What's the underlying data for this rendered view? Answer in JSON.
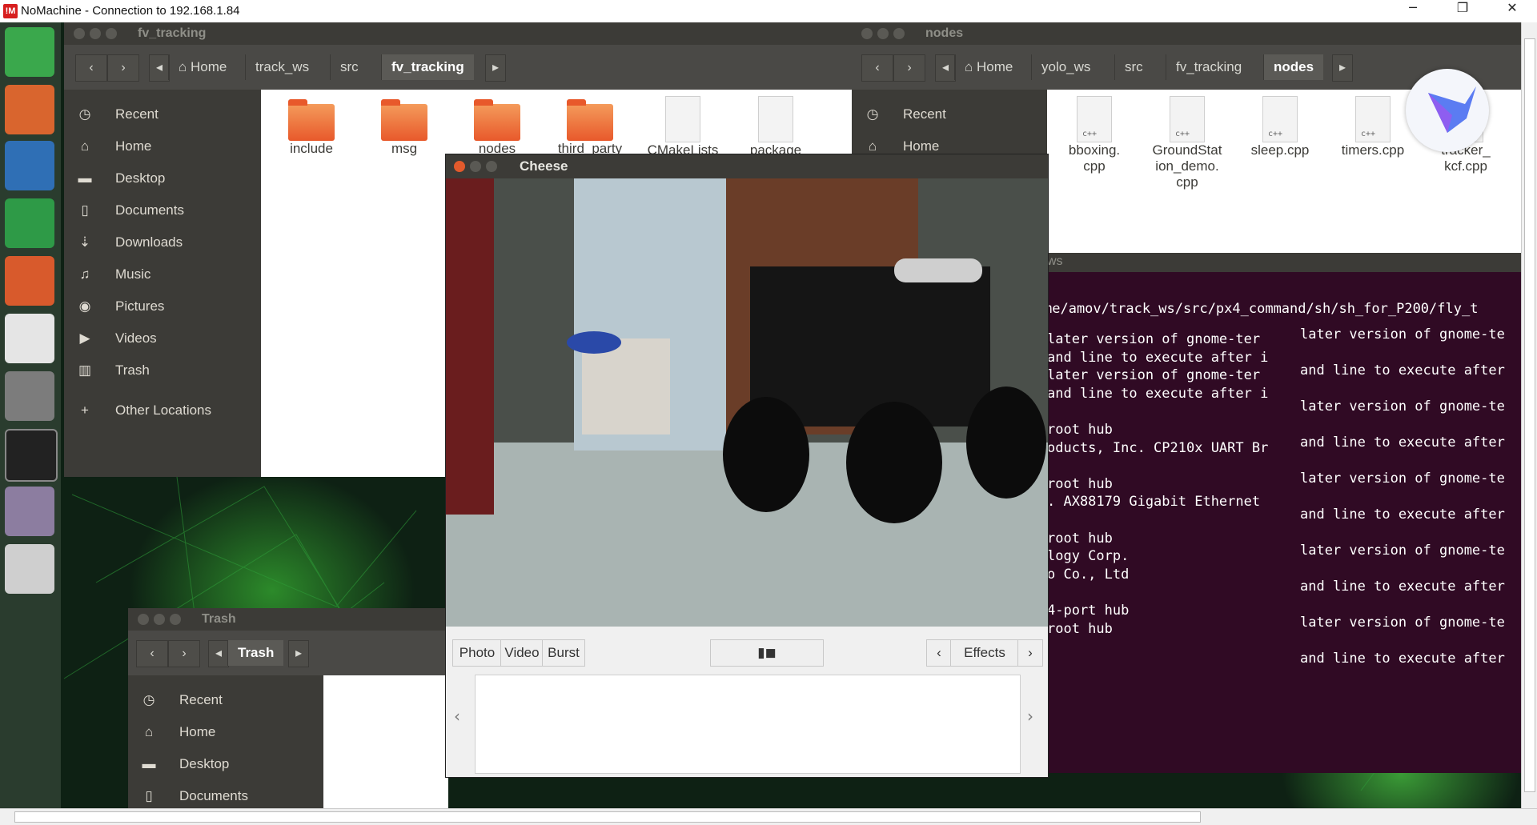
{
  "host": {
    "logo": "!M",
    "title": "NoMachine - Connection to 192.168.1.84",
    "minimize": "─",
    "restore": "❐",
    "close": "✕"
  },
  "fm_left": {
    "title": "fv_tracking",
    "back": "‹",
    "forward": "›",
    "crumb_prev": "◂",
    "crumb_next": "▸",
    "home_icon": "⌂",
    "breadcrumbs": [
      "Home",
      "track_ws",
      "src",
      "fv_tracking"
    ],
    "sidebar": [
      {
        "icon": "◷",
        "label": "Recent"
      },
      {
        "icon": "⌂",
        "label": "Home"
      },
      {
        "icon": "▬",
        "label": "Desktop"
      },
      {
        "icon": "▯",
        "label": "Documents"
      },
      {
        "icon": "⇣",
        "label": "Downloads"
      },
      {
        "icon": "♫",
        "label": "Music"
      },
      {
        "icon": "◉",
        "label": "Pictures"
      },
      {
        "icon": "▶",
        "label": "Videos"
      },
      {
        "icon": "▥",
        "label": "Trash"
      },
      {
        "icon": "+",
        "label": "Other Locations"
      }
    ],
    "files": [
      {
        "name": "include",
        "kind": "folder"
      },
      {
        "name": "msg",
        "kind": "folder"
      },
      {
        "name": "nodes",
        "kind": "folder"
      },
      {
        "name": "third_party",
        "kind": "folder"
      },
      {
        "name": "CMakeLists",
        "kind": "doc"
      },
      {
        "name": "package",
        "kind": "doc"
      }
    ]
  },
  "fm_right": {
    "title": "nodes",
    "breadcrumbs": [
      "Home",
      "yolo_ws",
      "src",
      "fv_tracking",
      "nodes"
    ],
    "sidebar": [
      {
        "icon": "◷",
        "label": "Recent"
      },
      {
        "icon": "⌂",
        "label": "Home"
      }
    ],
    "files": [
      {
        "name": "bboxing.\ncpp"
      },
      {
        "name": "GroundStat\nion_demo.\ncpp"
      },
      {
        "name": "sleep.cpp"
      },
      {
        "name": "timers.cpp"
      },
      {
        "name": "tracker_\nkcf.cpp"
      }
    ],
    "file_tag": "c++"
  },
  "trash": {
    "title": "Trash",
    "breadcrumb": "Trash",
    "sidebar": [
      {
        "icon": "◷",
        "label": "Recent"
      },
      {
        "icon": "⌂",
        "label": "Home"
      },
      {
        "icon": "▬",
        "label": "Desktop"
      },
      {
        "icon": "▯",
        "label": "Documents"
      }
    ]
  },
  "cheese": {
    "title": "Cheese",
    "modes": [
      "Photo",
      "Video",
      "Burst"
    ],
    "shutter_icon": "▮◼",
    "effects": "Effects",
    "prev": "‹",
    "next": "›"
  },
  "terminal": {
    "title_fragment": "ws",
    "path_line": "me/amov/track_ws/src/px4_command/sh/sh_for_P200/fly_t",
    "left_lines": [
      "later version of gnome-ter",
      "and line to execute after i",
      "later version of gnome-ter",
      "and line to execute after i",
      "",
      "root hub",
      "oducts, Inc. CP210x UART Br",
      "",
      "root hub",
      ". AX88179 Gigabit Ethernet",
      "",
      "root hub",
      "logy Corp.",
      "o Co., Ltd",
      "",
      "4-port hub",
      "root hub"
    ],
    "right_lines": [
      "later version of gnome-te",
      "and line to execute after",
      "later version of gnome-te",
      "and line to execute after",
      "later version of gnome-te",
      "and line to execute after",
      "later version of gnome-te",
      "and line to execute after",
      "later version of gnome-te",
      "and line to execute after"
    ]
  }
}
